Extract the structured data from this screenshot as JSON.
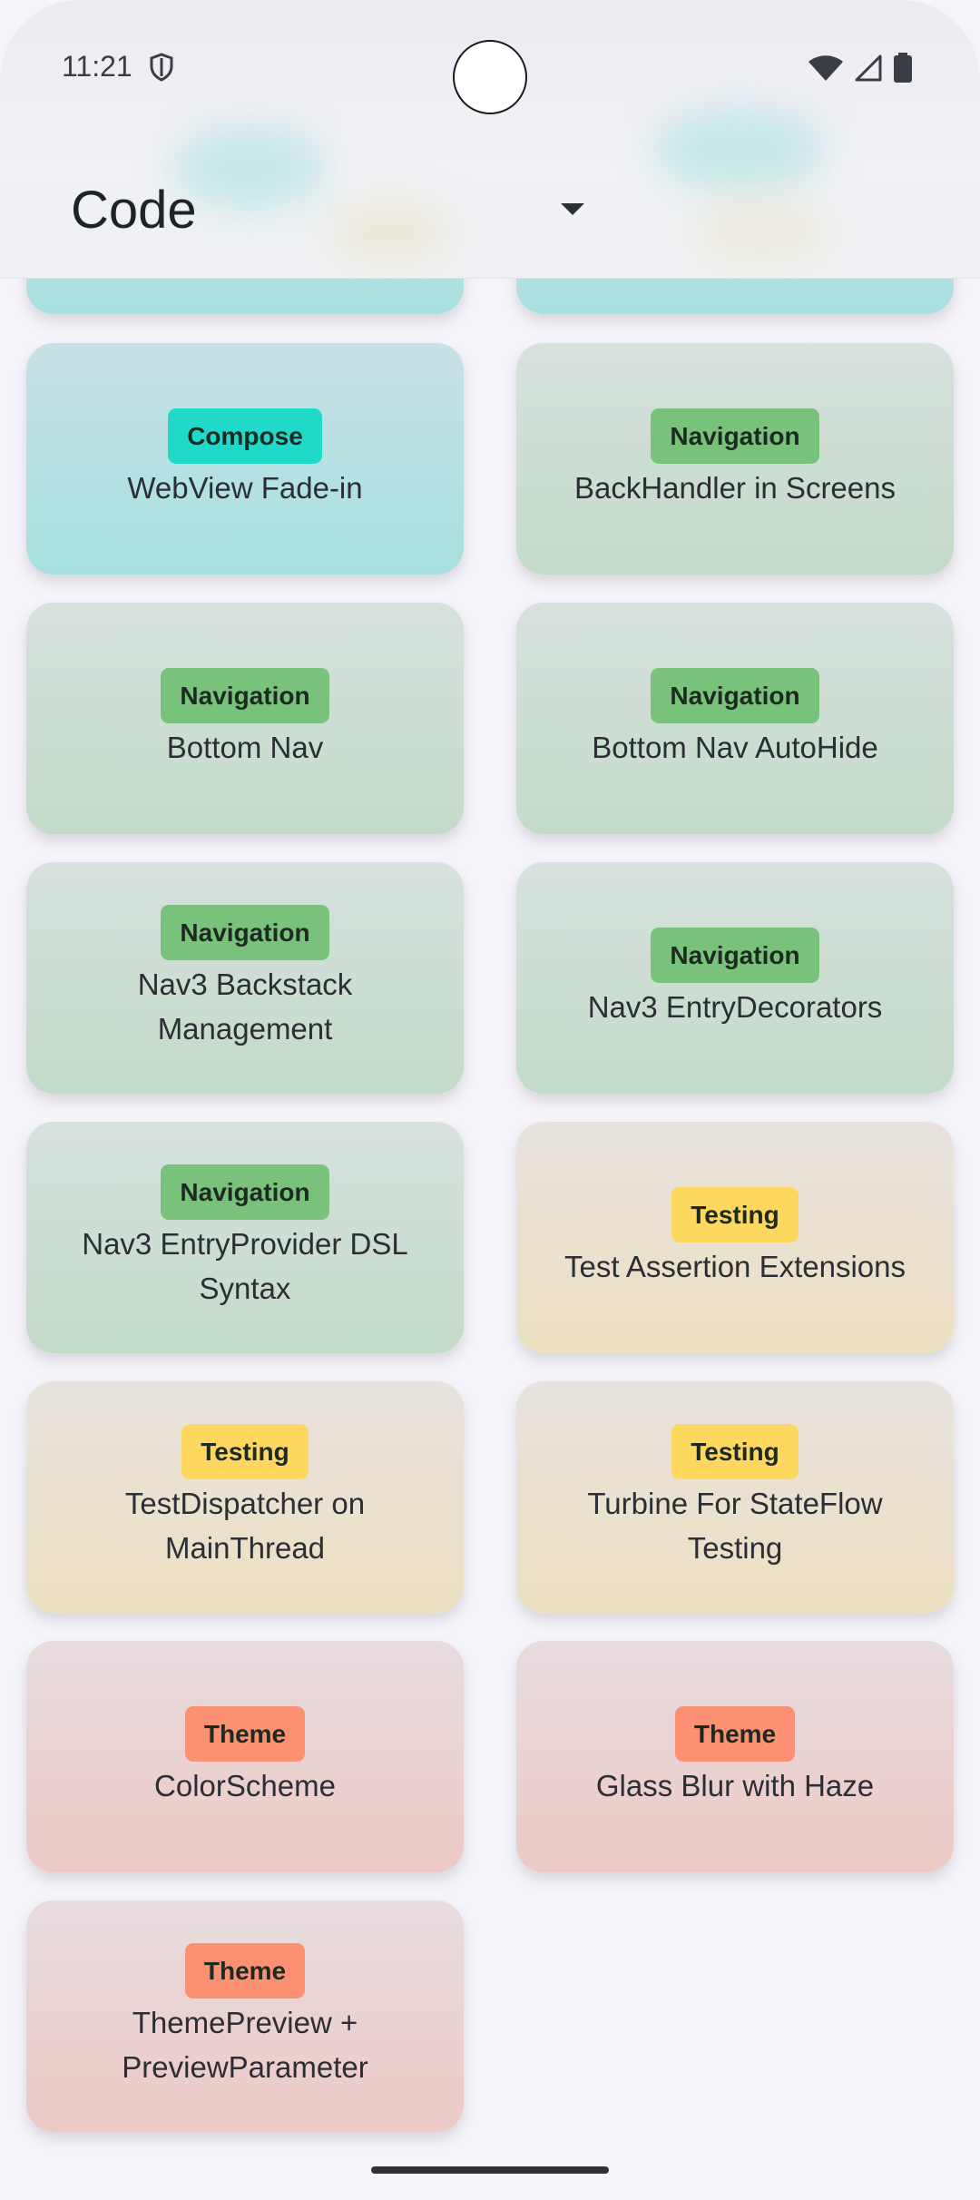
{
  "status_bar": {
    "time": "11:21",
    "icons": [
      "shield-icon",
      "wifi-icon",
      "signal-icon",
      "battery-icon"
    ]
  },
  "header": {
    "dropdown_value": "Code"
  },
  "colors": {
    "compose": "#21d9c8",
    "navigation": "#78c27b",
    "testing": "#fdd75e",
    "theme": "#fb9073"
  },
  "cards": [
    {
      "tag": "Compose",
      "title": "WebView Fade-in"
    },
    {
      "tag": "Navigation",
      "title": "BackHandler in Screens"
    },
    {
      "tag": "Navigation",
      "title": "Bottom Nav"
    },
    {
      "tag": "Navigation",
      "title": "Bottom Nav AutoHide"
    },
    {
      "tag": "Navigation",
      "title": "Nav3 Backstack Management"
    },
    {
      "tag": "Navigation",
      "title": "Nav3 EntryDecorators"
    },
    {
      "tag": "Navigation",
      "title": "Nav3 EntryProvider DSL Syntax"
    },
    {
      "tag": "Testing",
      "title": "Test Assertion Extensions"
    },
    {
      "tag": "Testing",
      "title": "TestDispatcher on MainThread"
    },
    {
      "tag": "Testing",
      "title": "Turbine For StateFlow Testing"
    },
    {
      "tag": "Theme",
      "title": "ColorScheme"
    },
    {
      "tag": "Theme",
      "title": "Glass Blur with Haze"
    },
    {
      "tag": "Theme",
      "title": "ThemePreview + PreviewParameter"
    }
  ]
}
